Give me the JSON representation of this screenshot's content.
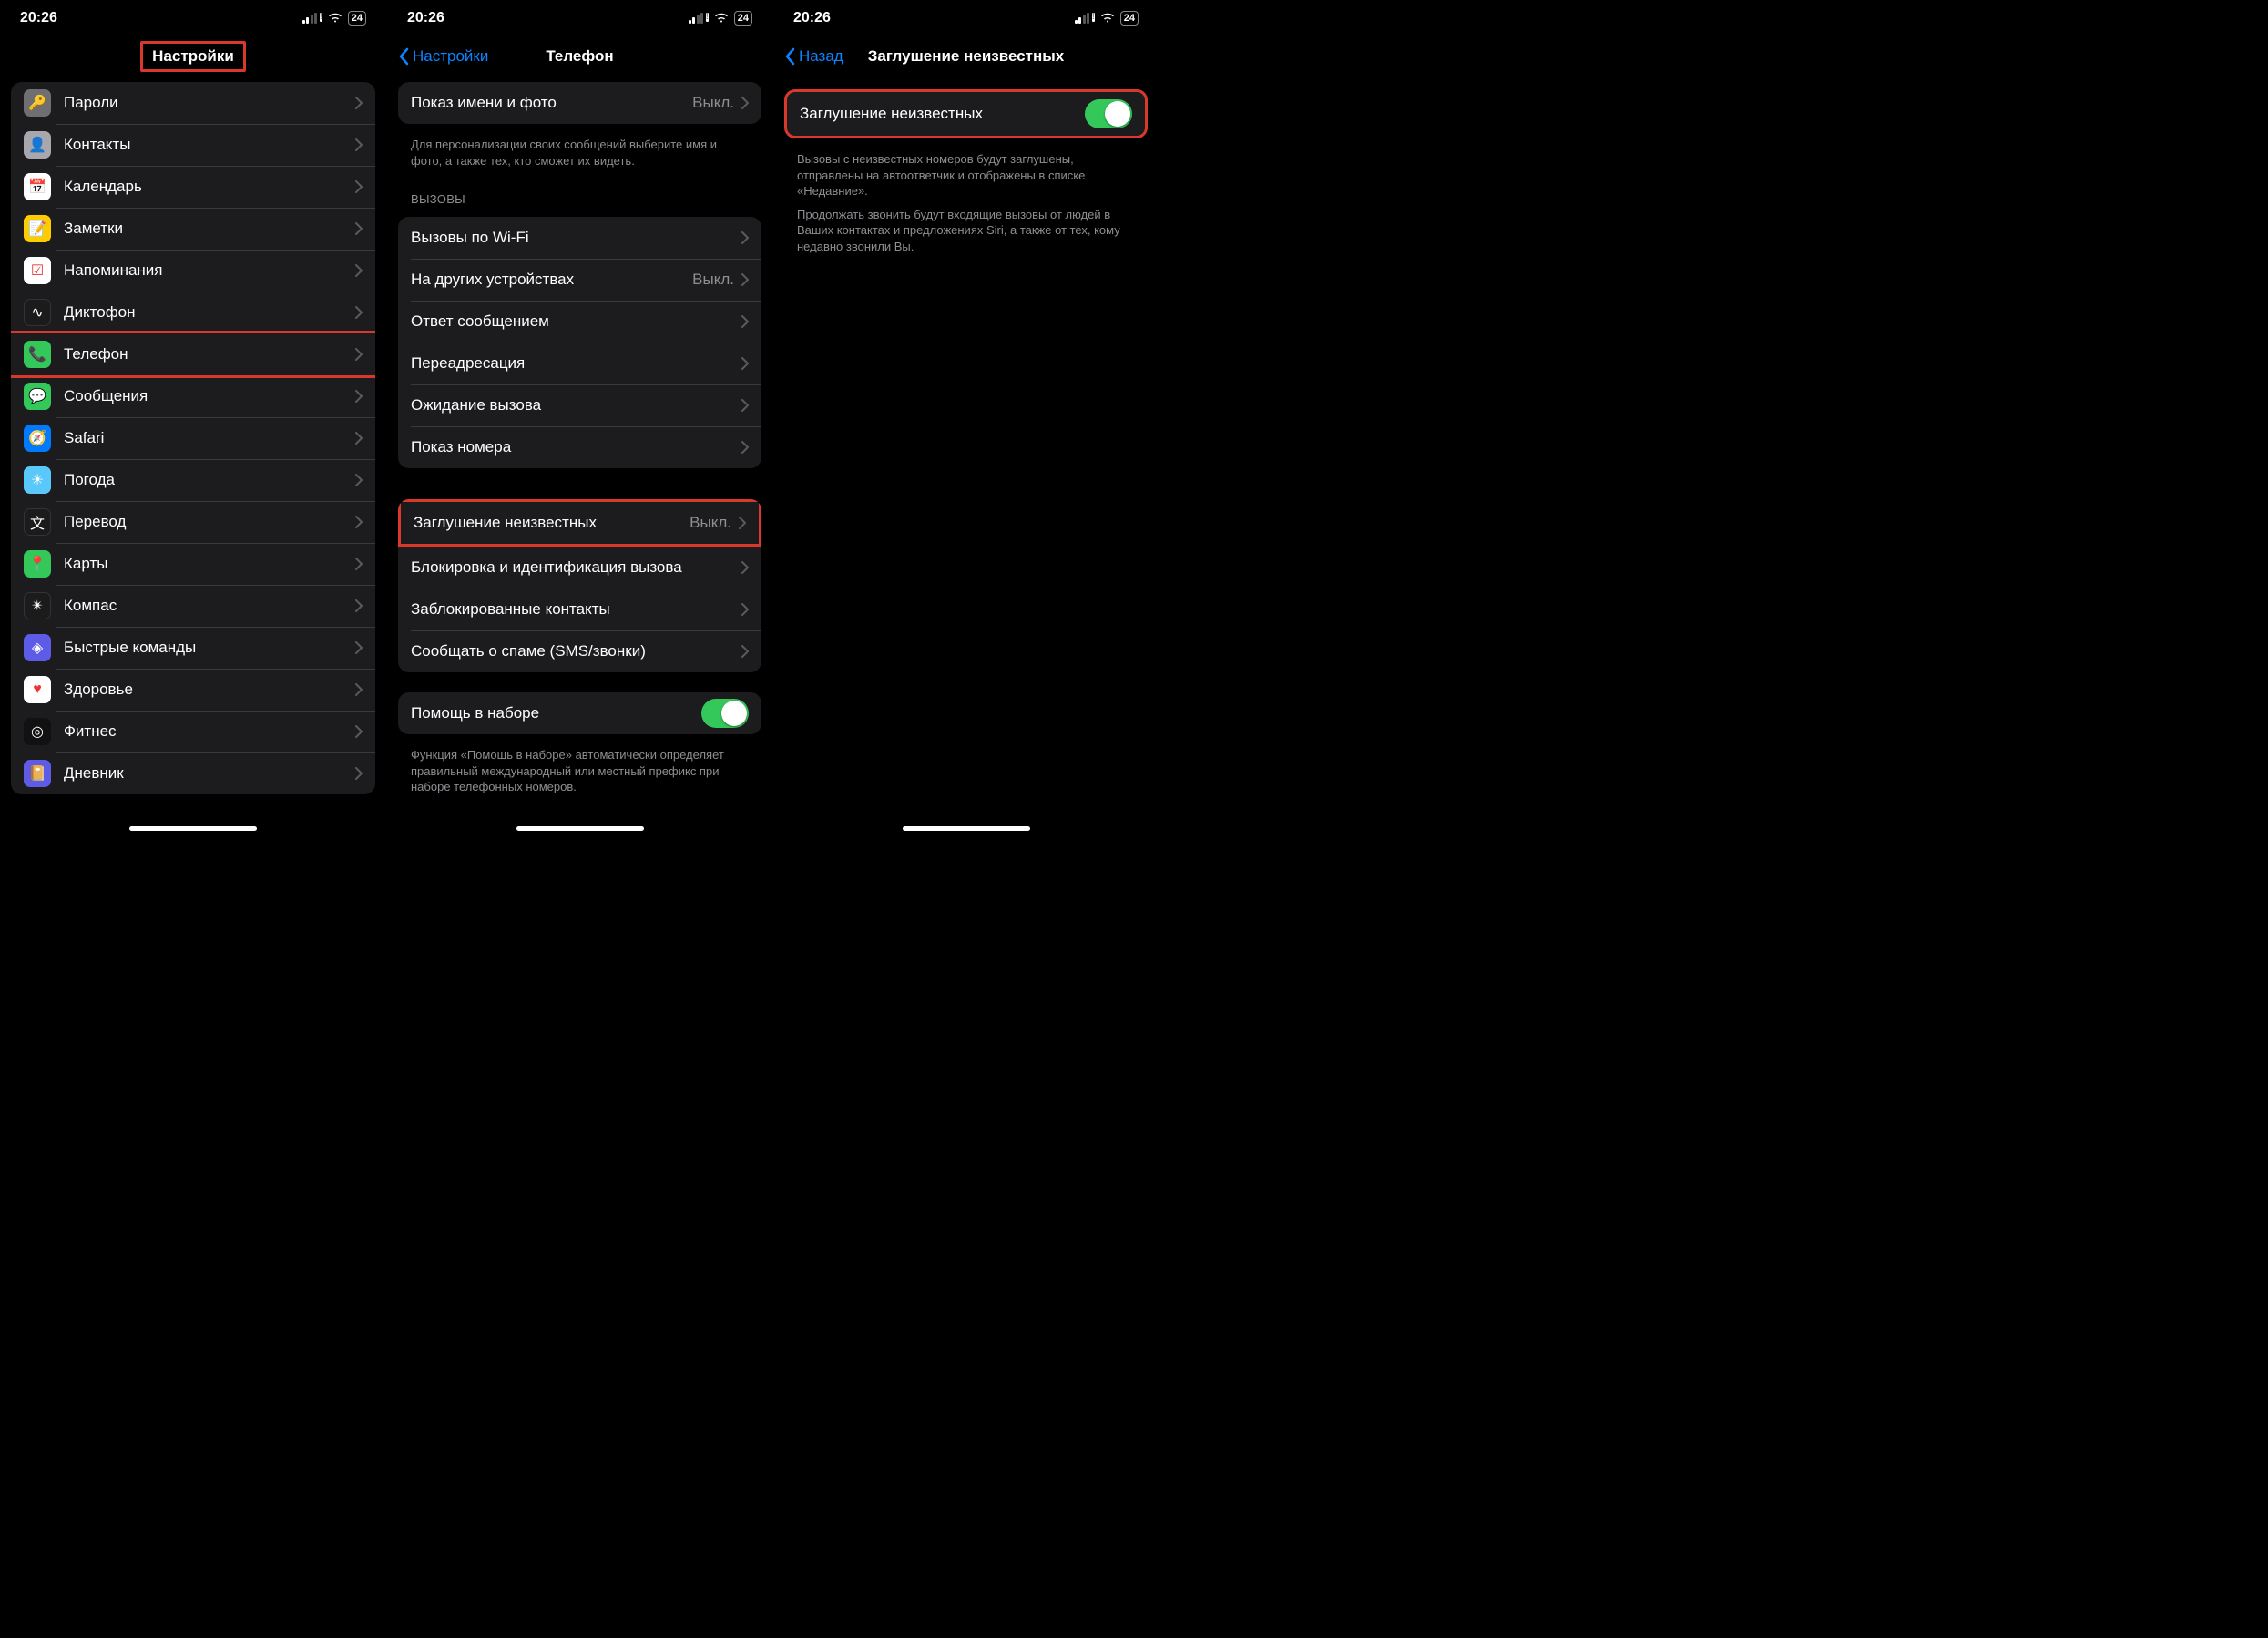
{
  "status": {
    "time": "20:26",
    "battery": "24"
  },
  "screen1": {
    "title": "Настройки",
    "items": [
      {
        "label": "Пароли",
        "icon": "key-icon",
        "color": "c-gray",
        "glyph": "🔑"
      },
      {
        "label": "Контакты",
        "icon": "contacts-icon",
        "color": "c-lgray",
        "glyph": "👤"
      },
      {
        "label": "Календарь",
        "icon": "calendar-icon",
        "color": "c-white",
        "glyph": "📅"
      },
      {
        "label": "Заметки",
        "icon": "notes-icon",
        "color": "c-yellow",
        "glyph": "📝"
      },
      {
        "label": "Напоминания",
        "icon": "reminders-icon",
        "color": "c-white",
        "glyph": "☑"
      },
      {
        "label": "Диктофон",
        "icon": "voice-memos-icon",
        "color": "c-dark",
        "glyph": "∿"
      },
      {
        "label": "Телефон",
        "icon": "phone-icon",
        "color": "c-green",
        "glyph": "📞",
        "highlight": true
      },
      {
        "label": "Сообщения",
        "icon": "messages-icon",
        "color": "c-green",
        "glyph": "💬"
      },
      {
        "label": "Safari",
        "icon": "safari-icon",
        "color": "c-blue",
        "glyph": "🧭"
      },
      {
        "label": "Погода",
        "icon": "weather-icon",
        "color": "c-lblue",
        "glyph": "☀"
      },
      {
        "label": "Перевод",
        "icon": "translate-icon",
        "color": "c-dark",
        "glyph": "文"
      },
      {
        "label": "Карты",
        "icon": "maps-icon",
        "color": "c-green",
        "glyph": "📍"
      },
      {
        "label": "Компас",
        "icon": "compass-icon",
        "color": "c-dark",
        "glyph": "✴"
      },
      {
        "label": "Быстрые команды",
        "icon": "shortcuts-icon",
        "color": "c-purple",
        "glyph": "◈"
      },
      {
        "label": "Здоровье",
        "icon": "health-icon",
        "color": "c-white",
        "glyph": "♥"
      },
      {
        "label": "Фитнес",
        "icon": "fitness-icon",
        "color": "c-black",
        "glyph": "◎"
      },
      {
        "label": "Дневник",
        "icon": "journal-icon",
        "color": "c-purple",
        "glyph": "📔"
      }
    ]
  },
  "screen2": {
    "back": "Настройки",
    "title": "Телефон",
    "group1": [
      {
        "label": "Показ имени и фото",
        "value": "Выкл."
      }
    ],
    "caption1": "Для персонализации своих сообщений выберите имя и фото, а также тех, кто сможет их видеть.",
    "section_calls": "ВЫЗОВЫ",
    "group2": [
      {
        "label": "Вызовы по Wi-Fi"
      },
      {
        "label": "На других устройствах",
        "value": "Выкл."
      },
      {
        "label": "Ответ сообщением"
      },
      {
        "label": "Переадресация"
      },
      {
        "label": "Ожидание вызова"
      },
      {
        "label": "Показ номера"
      }
    ],
    "group3": [
      {
        "label": "Заглушение неизвестных",
        "value": "Выкл.",
        "highlight": true
      },
      {
        "label": "Блокировка и идентификация вызова"
      },
      {
        "label": "Заблокированные контакты"
      },
      {
        "label": "Сообщать о спаме (SMS/звонки)"
      }
    ],
    "group4": {
      "label": "Помощь в наборе"
    },
    "caption2": "Функция «Помощь в наборе» автоматически определяет правильный международный или местный префикс при наборе телефонных номеров."
  },
  "screen3": {
    "back": "Назад",
    "title": "Заглушение неизвестных",
    "toggle_label": "Заглушение неизвестных",
    "caption1": "Вызовы с неизвестных номеров будут заглушены, отправлены на автоответчик и отображены в списке «Недавние».",
    "caption2": "Продолжать звонить будут входящие вызовы от людей в Ваших контактах и предложениях Siri, а также от тех, кому недавно звонили Вы."
  }
}
